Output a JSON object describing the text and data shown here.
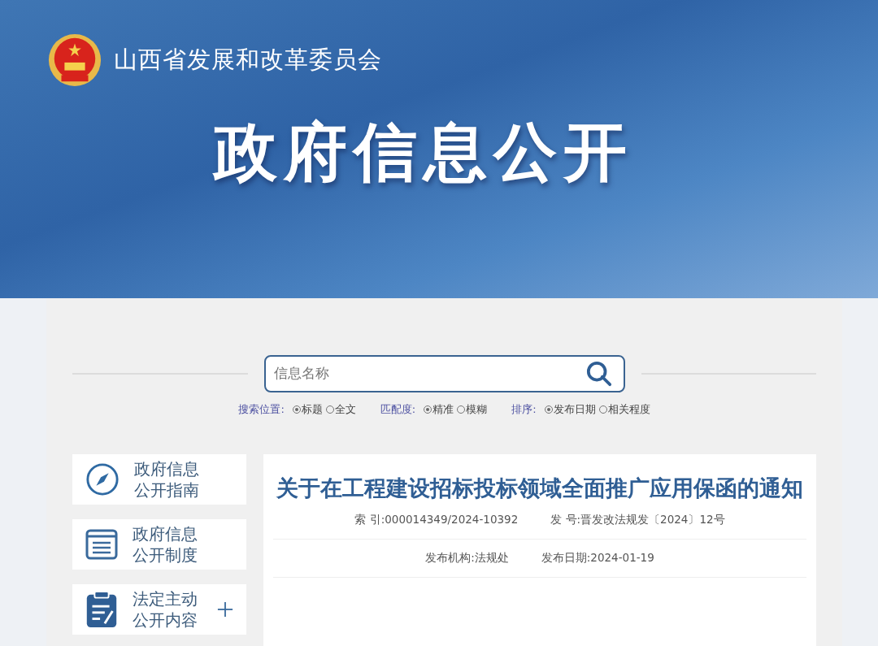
{
  "header": {
    "org_name": "山西省发展和改革委员会",
    "banner_title": "政府信息公开"
  },
  "search": {
    "placeholder": "信息名称"
  },
  "search_options": [
    {
      "label": "搜索位置:",
      "options": [
        {
          "label": "标题",
          "selected": true
        },
        {
          "label": "全文",
          "selected": false
        }
      ]
    },
    {
      "label": "匹配度:",
      "options": [
        {
          "label": "精准",
          "selected": true
        },
        {
          "label": "模糊",
          "selected": false
        }
      ]
    },
    {
      "label": "排序:",
      "options": [
        {
          "label": "发布日期",
          "selected": true
        },
        {
          "label": "相关程度",
          "selected": false
        }
      ]
    }
  ],
  "sidebar": {
    "items": [
      {
        "kind": "guide",
        "lines": [
          "政府信息",
          "公开指南"
        ]
      },
      {
        "kind": "rules",
        "lines": [
          "政府信息",
          "公开制度"
        ]
      },
      {
        "kind": "content",
        "lines": [
          "法定主动",
          "公开内容"
        ],
        "expanded": false
      }
    ]
  },
  "article": {
    "title": "关于在工程建设招标投标领域全面推广应用保函的通知",
    "meta_rows": [
      [
        {
          "label": "索 引:",
          "value": "000014349/2024-10392"
        },
        {
          "label": "发 号:",
          "value": "晋发改法规发〔2024〕12号"
        }
      ],
      [
        {
          "label": "发布机构:",
          "value": "法规处"
        },
        {
          "label": "发布日期:",
          "value": "2024-01-19"
        }
      ]
    ]
  }
}
